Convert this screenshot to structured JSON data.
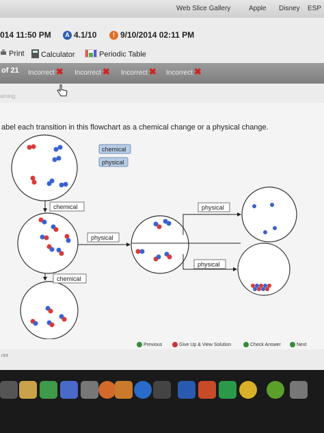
{
  "bookmarks": [
    "Web Slice Gallery",
    "Apple",
    "Disney",
    "ESP"
  ],
  "datebar": {
    "left_time": "014 11:50 PM",
    "score": "4.1/10",
    "due": "9/10/2014 02:11 PM"
  },
  "tools": {
    "print": "Print",
    "calculator": "Calculator",
    "periodic": "Periodic Table"
  },
  "tabs": {
    "of_count": "of 21",
    "items": [
      {
        "label": "Incorrect"
      },
      {
        "label": "Incorrect"
      },
      {
        "label": "Incorrect"
      },
      {
        "label": "Incorrect"
      }
    ]
  },
  "learning": "arning",
  "question": "abel each transition in this flowchart as a chemical change or a physical change.",
  "labels": {
    "bank_chemical": "chemical",
    "bank_physical": "physical",
    "t1": "chemical",
    "t2": "physical",
    "t3": "chemical",
    "t4": "physical",
    "t5": "physical"
  },
  "footer": {
    "previous": "Previous",
    "give_up": "Give Up & View Solution",
    "check": "Check Answer",
    "next": "Next"
  },
  "bottom_left": "rint",
  "colors": {
    "red_atom": "#d83a3a",
    "blue_atom": "#3a63d0",
    "tab_bg": "#8a8a8a",
    "incorrect_x": "#d42020"
  }
}
